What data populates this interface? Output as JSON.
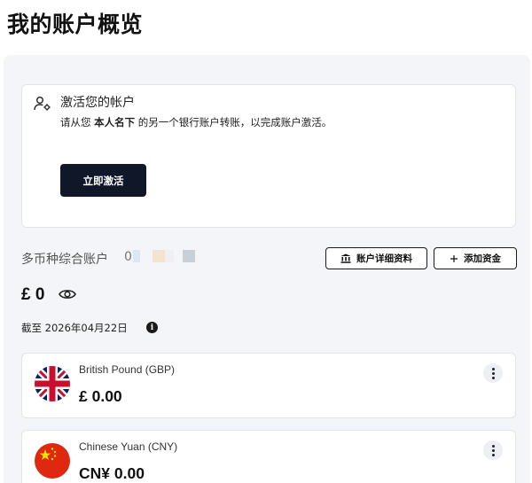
{
  "page": {
    "title": "我的账户概览"
  },
  "activation": {
    "title": "激活您的帐户",
    "desc_prefix": "请从您 ",
    "desc_bold": "本人名下",
    "desc_suffix": " 的另一个银行账户转账，以完成账户激活。",
    "button_label": "立即激活",
    "icon": "user-gear-icon"
  },
  "account": {
    "name": "多币种综合账户",
    "number_visible": "0(",
    "details_button": "账户详细资料",
    "details_icon": "bank-icon",
    "add_funds_button": "添加资金",
    "add_funds_icon": "plus-icon",
    "balance": "£ 0",
    "as_of": "截至 2026年04月22日",
    "info_glyph": "i"
  },
  "currencies": [
    {
      "name": "British Pound (GBP)",
      "balance": "£ 0.00",
      "flag": "uk-flag-icon"
    },
    {
      "name": "Chinese Yuan (CNY)",
      "balance": "CN¥ 0.00",
      "flag": "china-flag-icon"
    }
  ],
  "colors": {
    "primary_button": "#0f1729",
    "panel_bg": "#f3f5f8",
    "card_border": "#e1e4e9"
  }
}
